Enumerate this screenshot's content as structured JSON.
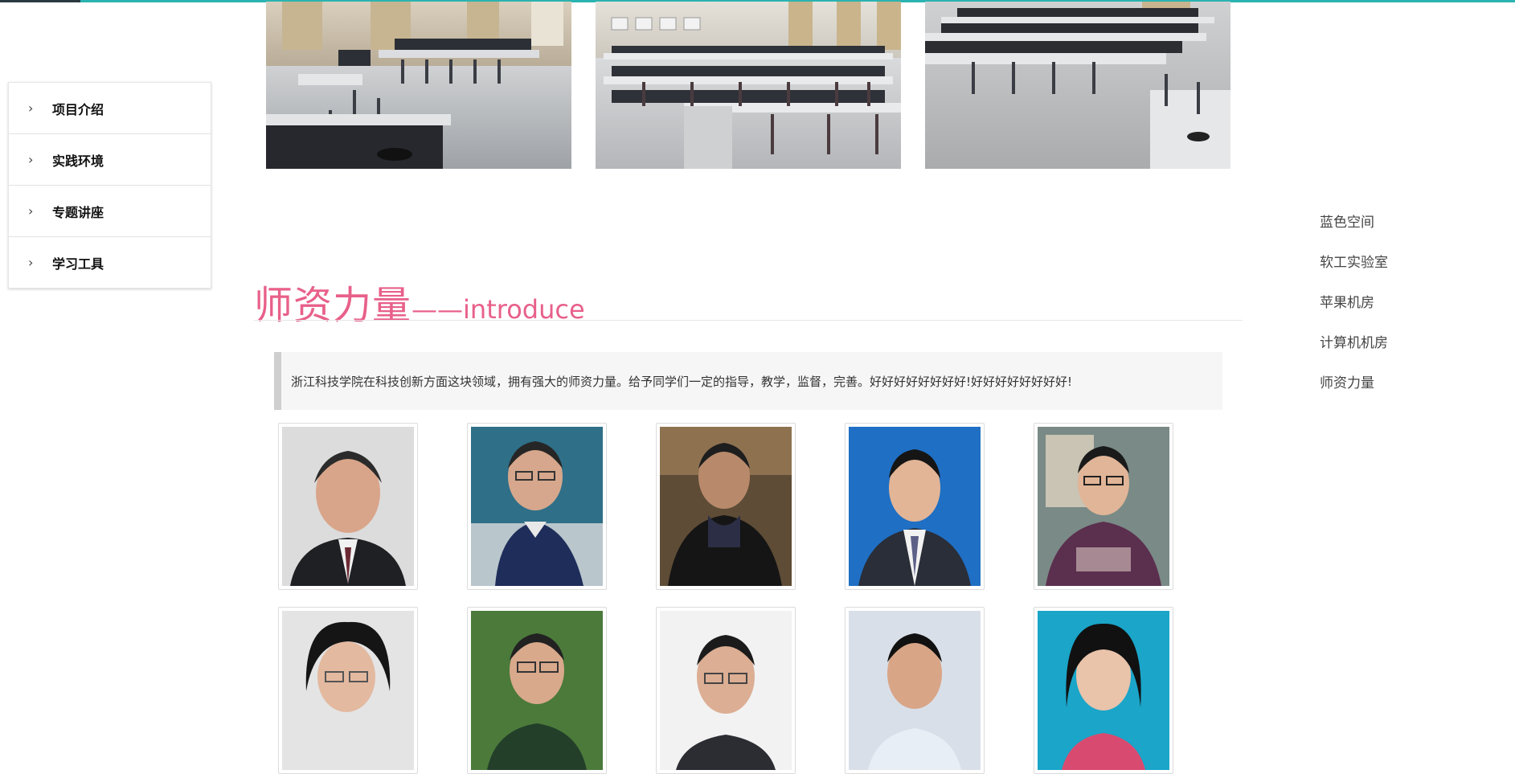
{
  "sidebar": {
    "items": [
      {
        "label": "项目介绍"
      },
      {
        "label": "实践环境"
      },
      {
        "label": "专题讲座"
      },
      {
        "label": "学习工具"
      }
    ]
  },
  "lab_photos": [
    {
      "name": "lab-photo-1"
    },
    {
      "name": "lab-photo-2"
    },
    {
      "name": "lab-photo-3"
    }
  ],
  "section": {
    "title_zh": "师资力量",
    "title_dash": "——",
    "title_en": "introduce"
  },
  "intro": {
    "text": "浙江科技学院在科技创新方面这块领域，拥有强大的师资力量。给予同学们一定的指导，教学，监督，完善。好好好好好好好好!好好好好好好好好!"
  },
  "right_nav": {
    "items": [
      {
        "label": "蓝色空间"
      },
      {
        "label": "软工实验室"
      },
      {
        "label": "苹果机房"
      },
      {
        "label": "计算机机房"
      },
      {
        "label": "师资力量"
      }
    ]
  },
  "colors": {
    "accent_teal": "#2ab3b1",
    "title_pink": "#e8608a",
    "quote_bg": "#f6f6f6",
    "quote_border": "#cfcfcf"
  }
}
